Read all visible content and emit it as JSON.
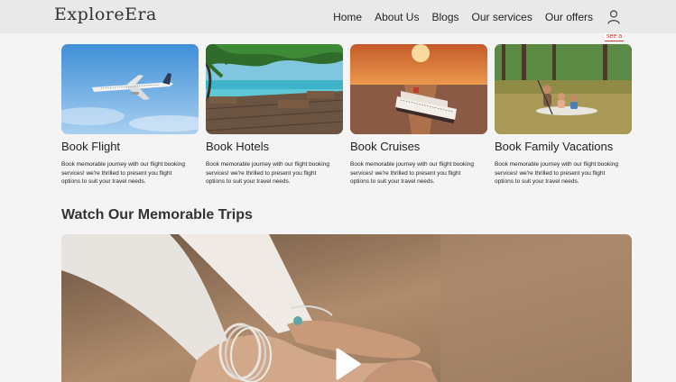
{
  "brand": {
    "name": "ExploreEra"
  },
  "nav": {
    "items": [
      {
        "label": "Home"
      },
      {
        "label": "About Us"
      },
      {
        "label": "Blogs"
      },
      {
        "label": "Our services"
      },
      {
        "label": "Our offers"
      }
    ],
    "user_icon": "user-icon"
  },
  "see_all": {
    "label": "see a"
  },
  "cards": [
    {
      "title": "Book Flight",
      "line1": "Book memorable journey with our flight booking",
      "line2": "services! we're thrilled to present you flight options to suit your travel needs.",
      "image": "airplane-in-sky"
    },
    {
      "title": "Book Hotels",
      "line1": "Book memorable journey with our flight booking",
      "line2": "services! we're thrilled to present you flight options to suit your travel needs.",
      "image": "resort-pool-deck"
    },
    {
      "title": "Book Cruises",
      "line1": "Book memorable journey with our flight booking",
      "line2": "services! we're thrilled to present you flight options to suit your travel needs.",
      "image": "cruise-ship-sunset"
    },
    {
      "title": "Book Family Vacations",
      "line1": "Book memorable journey with our flight booking",
      "line2": "services! we're thrilled to present you flight options to suit your travel needs.",
      "image": "family-paddleboard-lake"
    }
  ],
  "trips": {
    "title": "Watch Our Memorable Trips",
    "video_icon": "play-icon"
  },
  "colors": {
    "navbar": "#e9e9e9",
    "page": "#f4f4f4",
    "link_accent": "#c0392b"
  }
}
